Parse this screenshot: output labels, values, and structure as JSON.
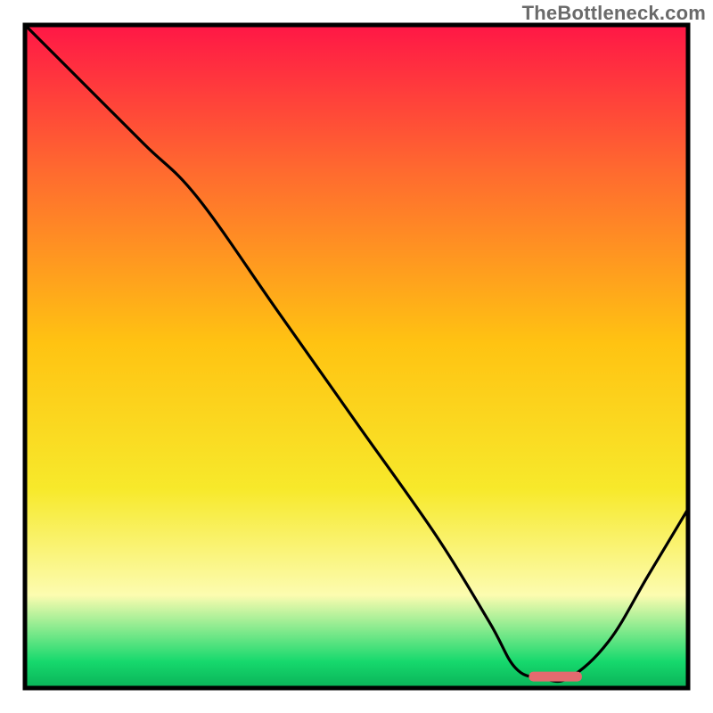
{
  "watermark": {
    "text": "TheBottleneck.com"
  },
  "colors": {
    "frame": "#000000",
    "curve": "#000000",
    "marker_fill": "#e46a6f",
    "marker_stroke": "#d45a60",
    "gradient": {
      "top": "#ff1746",
      "q1": "#ff6a2f",
      "mid": "#ffc312",
      "q3": "#f7e92b",
      "low": "#fcfcb0",
      "bottom": "#16d96d",
      "base": "#0ab258"
    }
  },
  "chart_data": {
    "type": "line",
    "title": "",
    "xlabel": "",
    "ylabel": "",
    "xlim": [
      0,
      100
    ],
    "ylim": [
      0,
      100
    ],
    "legend": false,
    "grid": false,
    "notes": "Single unlabeled curve over a red→green vertical gradient. Values are bottleneck-percentage (y) vs. an implicit parameter (x). A short marker segment sits at the curve's minimum near the bottom.",
    "series": [
      {
        "name": "bottleneck-curve",
        "x": [
          0,
          8,
          18,
          26,
          38,
          50,
          62,
          70,
          74,
          78,
          82,
          88,
          94,
          100
        ],
        "values": [
          100,
          92,
          82,
          74,
          57,
          40,
          23,
          10,
          3,
          1.5,
          1.5,
          7,
          17,
          27
        ]
      }
    ],
    "marker": {
      "x_start": 76,
      "x_end": 84,
      "y": 1.8
    }
  }
}
